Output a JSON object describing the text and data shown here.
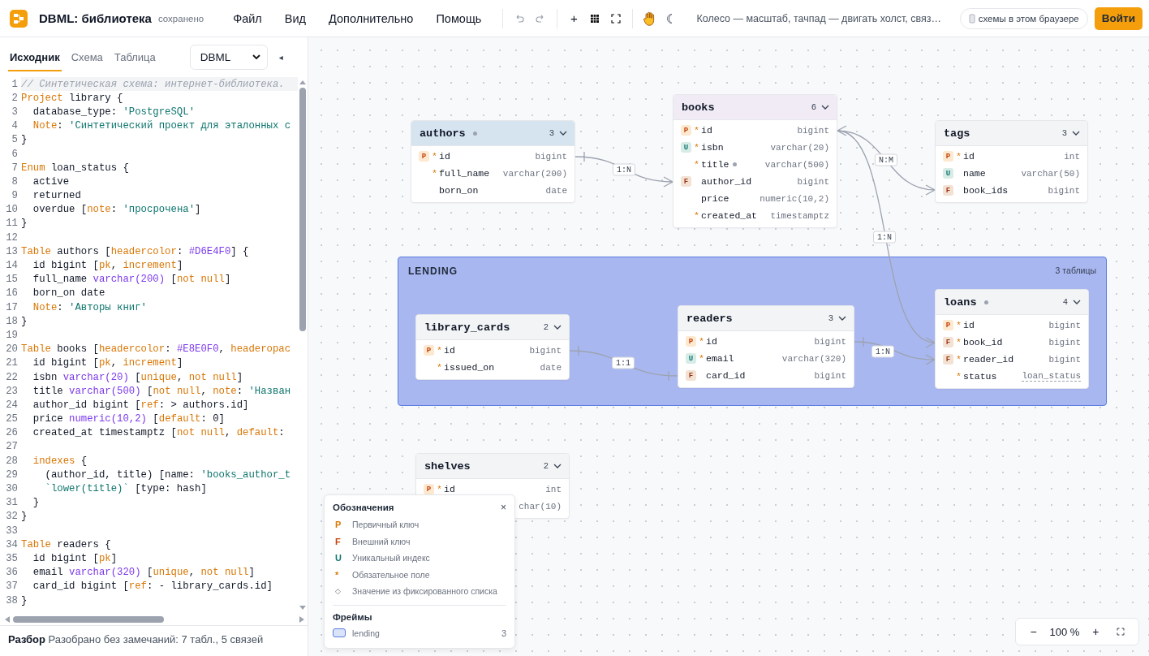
{
  "app": {
    "title": "DBML: библиотека",
    "save_state": "сохранено",
    "menu": [
      "Файл",
      "Вид",
      "Дополнительно",
      "Помощь"
    ],
    "add_label": "+",
    "hint": "Колесо — масштаб, тачпад — двигать холст, связ…",
    "storage_button": "схемы в этом браузере",
    "login_button": "Войти"
  },
  "left_panel": {
    "tabs": [
      {
        "label": "Исходник",
        "selected": true
      },
      {
        "label": "Схема",
        "selected": false
      },
      {
        "label": "Таблица",
        "selected": false
      }
    ],
    "format_select": "DBML",
    "collapse": "◂",
    "code": [
      {
        "n": "1",
        "current": true,
        "parts": [
          {
            "kind": "comment",
            "text": "// Синтетическая схема: интернет-библиотека."
          }
        ]
      },
      {
        "n": "2",
        "current": false,
        "parts": [
          {
            "kind": "keyword",
            "text": "Project"
          },
          {
            "kind": "plain",
            "text": " library {"
          }
        ]
      },
      {
        "n": "3",
        "current": false,
        "parts": [
          {
            "kind": "plain",
            "text": "  database_type: "
          },
          {
            "kind": "string",
            "text": "'PostgreSQL'"
          }
        ]
      },
      {
        "n": "4",
        "current": false,
        "parts": [
          {
            "kind": "keyword",
            "text": "  Note"
          },
          {
            "kind": "plain",
            "text": ": "
          },
          {
            "kind": "string",
            "text": "'Синтетический проект для эталонных с"
          }
        ]
      },
      {
        "n": "5",
        "current": false,
        "parts": [
          {
            "kind": "plain",
            "text": "}"
          }
        ]
      },
      {
        "n": "6",
        "current": false
      },
      {
        "n": "7",
        "current": false,
        "parts": [
          {
            "kind": "keyword",
            "text": "Enum"
          },
          {
            "kind": "plain",
            "text": " loan_status {"
          }
        ]
      },
      {
        "n": "8",
        "current": false,
        "parts": [
          {
            "kind": "plain",
            "text": "  active"
          }
        ]
      },
      {
        "n": "9",
        "current": false,
        "parts": [
          {
            "kind": "plain",
            "text": "  returned"
          }
        ]
      },
      {
        "n": "10",
        "current": false,
        "parts": [
          {
            "kind": "plain",
            "text": "  overdue ["
          },
          {
            "kind": "keyword",
            "text": "note"
          },
          {
            "kind": "plain",
            "text": ": "
          },
          {
            "kind": "string",
            "text": "'просрочена'"
          },
          {
            "kind": "plain",
            "text": "]"
          }
        ]
      },
      {
        "n": "11",
        "current": false,
        "parts": [
          {
            "kind": "plain",
            "text": "}"
          }
        ]
      },
      {
        "n": "12",
        "current": false
      },
      {
        "n": "13",
        "current": false,
        "parts": [
          {
            "kind": "keyword",
            "text": "Table"
          },
          {
            "kind": "plain",
            "text": " authors ["
          },
          {
            "kind": "keyword",
            "text": "headercolor"
          },
          {
            "kind": "plain",
            "text": ": "
          },
          {
            "kind": "type",
            "text": "#D6E4F0"
          },
          {
            "kind": "plain",
            "text": "] {"
          }
        ]
      },
      {
        "n": "14",
        "current": false,
        "parts": [
          {
            "kind": "plain",
            "text": "  id bigint ["
          },
          {
            "kind": "keyword",
            "text": "pk"
          },
          {
            "kind": "plain",
            "text": ", "
          },
          {
            "kind": "keyword",
            "text": "increment"
          },
          {
            "kind": "plain",
            "text": "]"
          }
        ]
      },
      {
        "n": "15",
        "current": false,
        "parts": [
          {
            "kind": "plain",
            "text": "  full_name "
          },
          {
            "kind": "type",
            "text": "varchar(200)"
          },
          {
            "kind": "plain",
            "text": " ["
          },
          {
            "kind": "keyword",
            "text": "not null"
          },
          {
            "kind": "plain",
            "text": "]"
          }
        ]
      },
      {
        "n": "16",
        "current": false,
        "parts": [
          {
            "kind": "plain",
            "text": "  born_on date"
          }
        ]
      },
      {
        "n": "17",
        "current": false,
        "parts": [
          {
            "kind": "keyword",
            "text": "  Note"
          },
          {
            "kind": "plain",
            "text": ": "
          },
          {
            "kind": "string",
            "text": "'Авторы книг'"
          }
        ]
      },
      {
        "n": "18",
        "current": false,
        "parts": [
          {
            "kind": "plain",
            "text": "}"
          }
        ]
      },
      {
        "n": "19",
        "current": false
      },
      {
        "n": "20",
        "current": false,
        "parts": [
          {
            "kind": "keyword",
            "text": "Table"
          },
          {
            "kind": "plain",
            "text": " books ["
          },
          {
            "kind": "keyword",
            "text": "headercolor"
          },
          {
            "kind": "plain",
            "text": ": "
          },
          {
            "kind": "type",
            "text": "#E8E0F0"
          },
          {
            "kind": "plain",
            "text": ", "
          },
          {
            "kind": "keyword",
            "text": "headeropac"
          }
        ]
      },
      {
        "n": "21",
        "current": false,
        "parts": [
          {
            "kind": "plain",
            "text": "  id bigint ["
          },
          {
            "kind": "keyword",
            "text": "pk"
          },
          {
            "kind": "plain",
            "text": ", "
          },
          {
            "kind": "keyword",
            "text": "increment"
          },
          {
            "kind": "plain",
            "text": "]"
          }
        ]
      },
      {
        "n": "22",
        "current": false,
        "parts": [
          {
            "kind": "plain",
            "text": "  isbn "
          },
          {
            "kind": "type",
            "text": "varchar(20)"
          },
          {
            "kind": "plain",
            "text": " ["
          },
          {
            "kind": "keyword",
            "text": "unique"
          },
          {
            "kind": "plain",
            "text": ", "
          },
          {
            "kind": "keyword",
            "text": "not null"
          },
          {
            "kind": "plain",
            "text": "]"
          }
        ]
      },
      {
        "n": "23",
        "current": false,
        "parts": [
          {
            "kind": "plain",
            "text": "  title "
          },
          {
            "kind": "type",
            "text": "varchar(500)"
          },
          {
            "kind": "plain",
            "text": " ["
          },
          {
            "kind": "keyword",
            "text": "not null"
          },
          {
            "kind": "plain",
            "text": ", "
          },
          {
            "kind": "keyword",
            "text": "note"
          },
          {
            "kind": "plain",
            "text": ": "
          },
          {
            "kind": "string",
            "text": "'Назван"
          }
        ]
      },
      {
        "n": "24",
        "current": false,
        "parts": [
          {
            "kind": "plain",
            "text": "  author_id bigint ["
          },
          {
            "kind": "keyword",
            "text": "ref"
          },
          {
            "kind": "plain",
            "text": ": > authors.id]"
          }
        ]
      },
      {
        "n": "25",
        "current": false,
        "parts": [
          {
            "kind": "plain",
            "text": "  price "
          },
          {
            "kind": "type",
            "text": "numeric(10,2)"
          },
          {
            "kind": "plain",
            "text": " ["
          },
          {
            "kind": "keyword",
            "text": "default"
          },
          {
            "kind": "plain",
            "text": ": 0]"
          }
        ]
      },
      {
        "n": "26",
        "current": false,
        "parts": [
          {
            "kind": "plain",
            "text": "  created_at timestamptz ["
          },
          {
            "kind": "keyword",
            "text": "not null"
          },
          {
            "kind": "plain",
            "text": ", "
          },
          {
            "kind": "keyword",
            "text": "default"
          },
          {
            "kind": "plain",
            "text": ":"
          }
        ]
      },
      {
        "n": "27",
        "current": false
      },
      {
        "n": "28",
        "current": false,
        "parts": [
          {
            "kind": "keyword",
            "text": "  indexes"
          },
          {
            "kind": "plain",
            "text": " {"
          }
        ]
      },
      {
        "n": "29",
        "current": false,
        "parts": [
          {
            "kind": "plain",
            "text": "    (author_id, title) [name: "
          },
          {
            "kind": "string",
            "text": "'books_author_t"
          }
        ]
      },
      {
        "n": "30",
        "current": false,
        "parts": [
          {
            "kind": "string",
            "text": "    `lower(title)`"
          },
          {
            "kind": "plain",
            "text": " [type: hash]"
          }
        ]
      },
      {
        "n": "31",
        "current": false,
        "parts": [
          {
            "kind": "plain",
            "text": "  }"
          }
        ]
      },
      {
        "n": "32",
        "current": false,
        "parts": [
          {
            "kind": "plain",
            "text": "}"
          }
        ]
      },
      {
        "n": "33",
        "current": false
      },
      {
        "n": "34",
        "current": false,
        "parts": [
          {
            "kind": "keyword",
            "text": "Table"
          },
          {
            "kind": "plain",
            "text": " readers {"
          }
        ]
      },
      {
        "n": "35",
        "current": false,
        "parts": [
          {
            "kind": "plain",
            "text": "  id bigint ["
          },
          {
            "kind": "keyword",
            "text": "pk"
          },
          {
            "kind": "plain",
            "text": "]"
          }
        ]
      },
      {
        "n": "36",
        "current": false,
        "parts": [
          {
            "kind": "plain",
            "text": "  email "
          },
          {
            "kind": "type",
            "text": "varchar(320)"
          },
          {
            "kind": "plain",
            "text": " ["
          },
          {
            "kind": "keyword",
            "text": "unique"
          },
          {
            "kind": "plain",
            "text": ", "
          },
          {
            "kind": "keyword",
            "text": "not null"
          },
          {
            "kind": "plain",
            "text": "]"
          }
        ]
      },
      {
        "n": "37",
        "current": false,
        "parts": [
          {
            "kind": "plain",
            "text": "  card_id bigint ["
          },
          {
            "kind": "keyword",
            "text": "ref"
          },
          {
            "kind": "plain",
            "text": ": - library_cards.id]"
          }
        ]
      },
      {
        "n": "38",
        "current": false,
        "parts": [
          {
            "kind": "plain",
            "text": "}"
          }
        ]
      }
    ],
    "status": "**Разбор** Разобрано без замечаний: 7 табл., 5 связей"
  },
  "canvas": {
    "frame": {
      "title": "LENDING",
      "count": "3 таблицы"
    },
    "tables": [
      {
        "name": "authors",
        "note": true,
        "count": "3",
        "color": "#d6e4f0",
        "fields": [
          {
            "key": {
              "kind": "pk",
              "letter": "P"
            },
            "mark": "*",
            "name": "id",
            "type": "bigint"
          },
          {
            "mark": "*",
            "name": "full_name",
            "type": "varchar(200)"
          },
          {
            "name": "born_on",
            "type": "date"
          }
        ]
      },
      {
        "name": "books",
        "note": false,
        "count": "6",
        "color": "#f1ebf6",
        "fields": [
          {
            "key": {
              "kind": "pk",
              "letter": "P"
            },
            "mark": "*",
            "name": "id",
            "type": "bigint"
          },
          {
            "key": {
              "kind": "unique",
              "letter": "U"
            },
            "mark": "*",
            "name": "isbn",
            "type": "varchar(20)"
          },
          {
            "mark": "*",
            "name": "title",
            "note": true,
            "type": "varchar(500)"
          },
          {
            "key": {
              "kind": "fk",
              "letter": "F"
            },
            "name": "author_id",
            "type": "bigint"
          },
          {
            "name": "price",
            "type": "numeric(10,2)"
          },
          {
            "mark": "*",
            "name": "created_at",
            "type": "timestamptz"
          }
        ]
      },
      {
        "name": "tags",
        "note": false,
        "count": "3",
        "color": "#f3f4f6",
        "fields": [
          {
            "key": {
              "kind": "pk",
              "letter": "P"
            },
            "mark": "*",
            "name": "id",
            "type": "int"
          },
          {
            "key": {
              "kind": "unique",
              "letter": "U"
            },
            "name": "name",
            "type": "varchar(50)"
          },
          {
            "key": {
              "kind": "fk",
              "letter": "F"
            },
            "name": "book_ids",
            "type": "bigint"
          }
        ]
      },
      {
        "name": "library_cards",
        "note": false,
        "count": "2",
        "color": "#f3f4f6",
        "fields": [
          {
            "key": {
              "kind": "pk",
              "letter": "P"
            },
            "mark": "*",
            "name": "id",
            "type": "bigint"
          },
          {
            "mark": "*",
            "name": "issued_on",
            "type": "date"
          }
        ]
      },
      {
        "name": "readers",
        "note": false,
        "count": "3",
        "color": "#f3f4f6",
        "fields": [
          {
            "key": {
              "kind": "pk",
              "letter": "P"
            },
            "mark": "*",
            "name": "id",
            "type": "bigint"
          },
          {
            "key": {
              "kind": "unique",
              "letter": "U"
            },
            "mark": "*",
            "name": "email",
            "type": "varchar(320)"
          },
          {
            "key": {
              "kind": "fk",
              "letter": "F"
            },
            "name": "card_id",
            "type": "bigint"
          }
        ]
      },
      {
        "name": "loans",
        "note": true,
        "count": "4",
        "color": "#f3f4f6",
        "fields": [
          {
            "key": {
              "kind": "pk",
              "letter": "P"
            },
            "mark": "*",
            "name": "id",
            "type": "bigint"
          },
          {
            "key": {
              "kind": "fk",
              "letter": "F"
            },
            "mark": "*",
            "name": "book_id",
            "type": "bigint"
          },
          {
            "key": {
              "kind": "fk",
              "letter": "F"
            },
            "mark": "*",
            "name": "reader_id",
            "type": "bigint"
          },
          {
            "mark": "*",
            "name": "status",
            "type": "loan_status",
            "enum": true
          }
        ]
      },
      {
        "name": "shelves",
        "note": false,
        "count": "2",
        "color": "#f3f4f6",
        "fields": [
          {
            "key": {
              "kind": "pk",
              "letter": "P"
            },
            "mark": "*",
            "name": "id",
            "type": "int"
          },
          {
            "type": "char(10)"
          }
        ]
      }
    ],
    "relations": [
      {
        "label": "1:N"
      },
      {
        "label": "N:M"
      },
      {
        "label": "1:N"
      },
      {
        "label": "1:1"
      },
      {
        "label": "1:N"
      }
    ],
    "legend": {
      "title": "Обозначения",
      "close": "×",
      "items": [
        {
          "kind": "pk",
          "symbol": "P",
          "label": "Первичный ключ"
        },
        {
          "kind": "fk",
          "symbol": "F",
          "label": "Внешний ключ"
        },
        {
          "kind": "unique",
          "symbol": "U",
          "label": "Уникальный индекс"
        },
        {
          "kind": "required",
          "symbol": "*",
          "label": "Обязательное поле"
        },
        {
          "kind": "enum",
          "symbol": "◇",
          "label": "Значение из фиксированного списка"
        }
      ],
      "frames_title": "Фреймы",
      "frames": [
        {
          "name": "lending",
          "count": "3"
        }
      ]
    },
    "zoom": {
      "minus": "−",
      "value": "100 %",
      "plus": "+"
    }
  }
}
